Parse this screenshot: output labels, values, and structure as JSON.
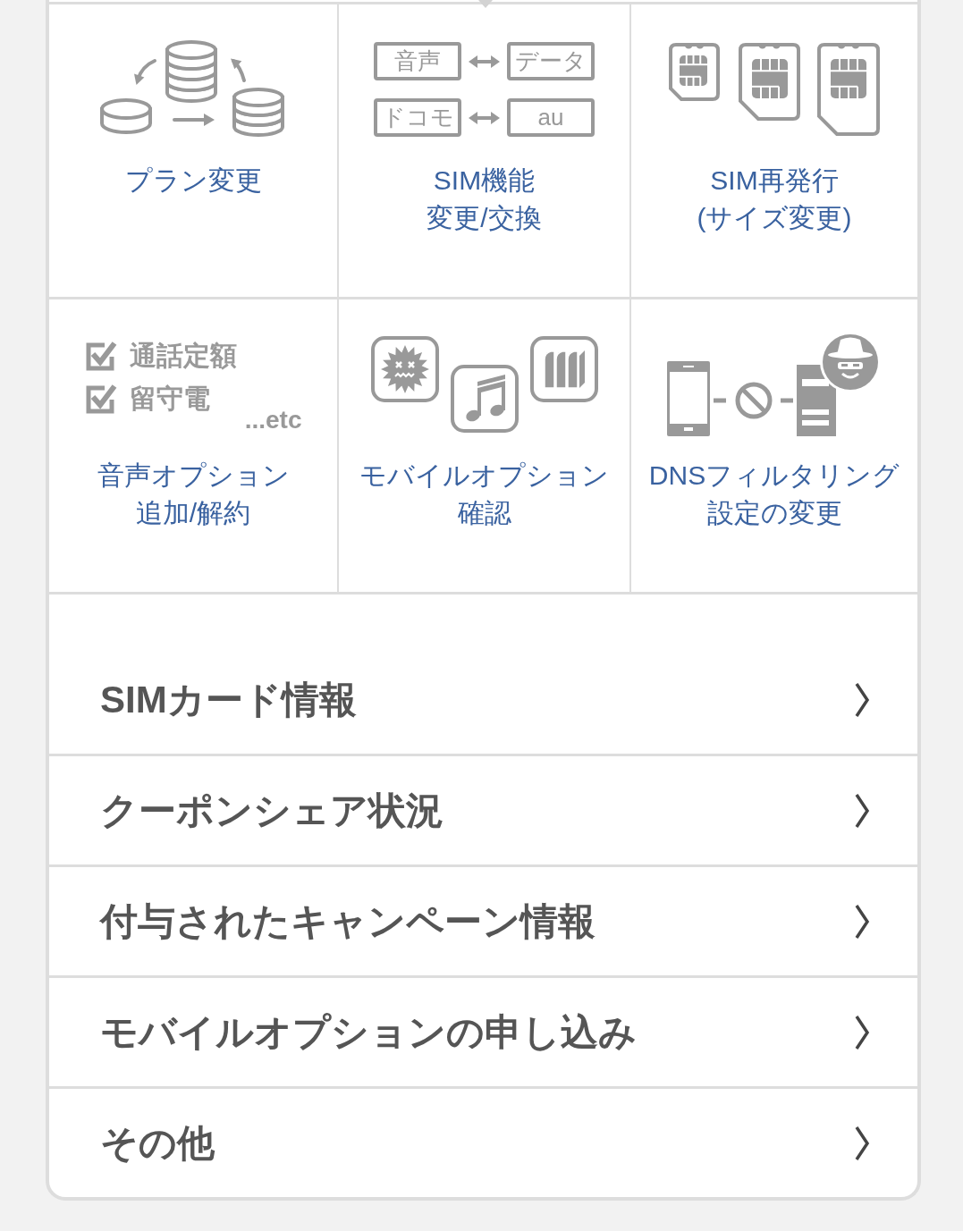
{
  "tiles": [
    {
      "kind": "plan",
      "label": [
        "プラン変更"
      ]
    },
    {
      "kind": "swap",
      "swaps": [
        {
          "from": "音声",
          "to": "データ"
        },
        {
          "from": "ドコモ",
          "to": "au"
        }
      ],
      "label": [
        "SIM機能",
        "変更/交換"
      ]
    },
    {
      "kind": "sim",
      "label": [
        "SIM再発行",
        "(サイズ変更)"
      ]
    },
    {
      "kind": "checklist",
      "options": [
        "通話定額",
        "留守電"
      ],
      "more": "...etc",
      "label": [
        "音声オプション",
        "追加/解約"
      ]
    },
    {
      "kind": "apps",
      "label": [
        "モバイルオプション",
        "確認"
      ]
    },
    {
      "kind": "dns",
      "label": [
        "DNSフィルタリング",
        "設定の変更"
      ]
    }
  ],
  "menu": [
    {
      "label": "SIMカード情報"
    },
    {
      "label": "クーポンシェア状況"
    },
    {
      "label": "付与されたキャンペーン情報"
    },
    {
      "label": "モバイルオプションの申し込み"
    },
    {
      "label": "その他"
    }
  ]
}
